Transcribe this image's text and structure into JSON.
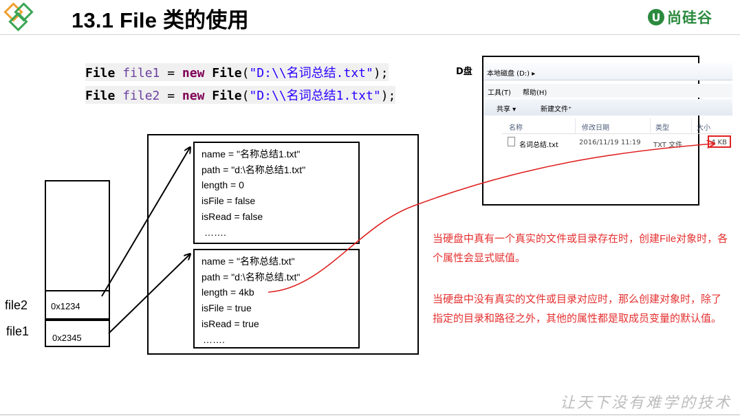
{
  "header": {
    "title": "13.1 File 类的使用",
    "brand_mark": "U",
    "brand_name": "尚硅谷"
  },
  "code": {
    "line1": {
      "type": "File",
      "var": "file1",
      "eq": " = ",
      "new": "new",
      "ctor": "File",
      "open": "(",
      "arg": "\"D:\\\\名词总结.txt\"",
      "close": ");"
    },
    "line2": {
      "type": "File",
      "var": "file2",
      "eq": " = ",
      "new": "new",
      "ctor": "File",
      "open": "(",
      "arg": "\"D:\\\\名词总结1.txt\"",
      "close": ");"
    }
  },
  "stack": {
    "file2": {
      "label": "file2",
      "address": "0x1234"
    },
    "file1": {
      "label": "file1",
      "address": "0x2345"
    }
  },
  "heap": {
    "object1": {
      "fields": [
        "name = \"名称总结1.txt\"",
        "path = \"d:\\名称总结1.txt\"",
        "length = 0",
        "isFile = false",
        "isRead = false",
        "……."
      ]
    },
    "object2": {
      "fields": [
        "name = \"名称总结.txt\"",
        "path = \"d:\\名称总结.txt\"",
        "length = 4kb",
        "isFile = true",
        "isRead = true",
        "……."
      ]
    }
  },
  "explorer": {
    "drive_label": "D盘",
    "address": "本地磁盘 (D:) ▸",
    "menu": {
      "tools": "工具(T)",
      "help": "帮助(H)"
    },
    "toolbar": {
      "share": "共享 ▾",
      "new_folder": "新建文件⁺"
    },
    "columns": {
      "name": "名称",
      "modified": "修改日期",
      "type": "类型",
      "size": "大小"
    },
    "file": {
      "name": "名词总结.txt",
      "modified": "2016/11/19 11:19",
      "type": "TXT 文件",
      "size": "4 KB"
    }
  },
  "notes": {
    "note1": "当硬盘中真有一个真实的文件或目录存在时，创建File对象时，各个属性会显式赋值。",
    "note2": "当硬盘中没有真实的文件或目录对应时，那么创建对象时，除了指定的目录和路径之外，其他的属性都是取成员变量的默认值。"
  },
  "footer": {
    "slogan": "让天下没有难学的技术"
  },
  "colors": {
    "note_red": "#e53030",
    "brand_green": "#2b8a3e",
    "logo_orange": "#f0a030",
    "logo_green": "#3aa655"
  }
}
